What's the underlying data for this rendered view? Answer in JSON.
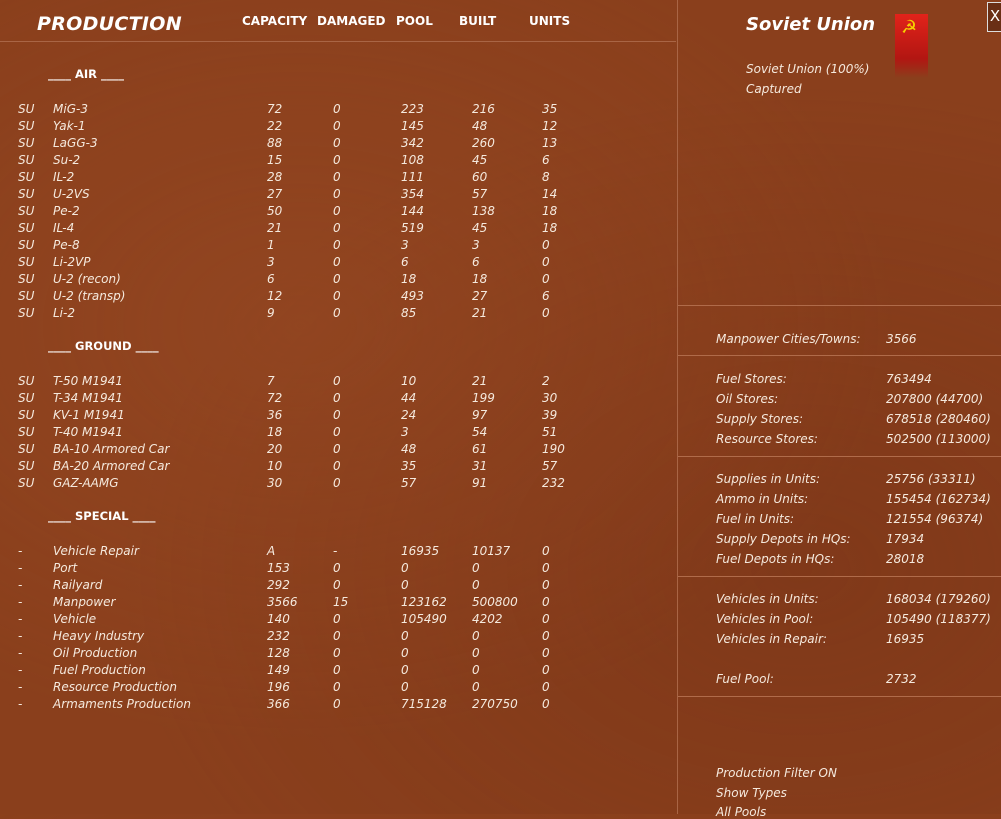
{
  "header": {
    "title": "PRODUCTION",
    "columns": {
      "capacity": "CAPACITY",
      "damaged": "DAMAGED",
      "pool": "POOL",
      "built": "BUILT",
      "units": "UNITS"
    }
  },
  "sections": [
    {
      "label": "____  AIR  ____",
      "rows": [
        [
          "SU",
          "MiG-3",
          "72",
          "0",
          "223",
          "216",
          "35"
        ],
        [
          "SU",
          "Yak-1",
          "22",
          "0",
          "145",
          "48",
          "12"
        ],
        [
          "SU",
          "LaGG-3",
          "88",
          "0",
          "342",
          "260",
          "13"
        ],
        [
          "SU",
          "Su-2",
          "15",
          "0",
          "108",
          "45",
          "6"
        ],
        [
          "SU",
          "IL-2",
          "28",
          "0",
          "111",
          "60",
          "8"
        ],
        [
          "SU",
          "U-2VS",
          "27",
          "0",
          "354",
          "57",
          "14"
        ],
        [
          "SU",
          "Pe-2",
          "50",
          "0",
          "144",
          "138",
          "18"
        ],
        [
          "SU",
          "IL-4",
          "21",
          "0",
          "519",
          "45",
          "18"
        ],
        [
          "SU",
          "Pe-8",
          "1",
          "0",
          "3",
          "3",
          "0"
        ],
        [
          "SU",
          "Li-2VP",
          "3",
          "0",
          "6",
          "6",
          "0"
        ],
        [
          "SU",
          "U-2 (recon)",
          "6",
          "0",
          "18",
          "18",
          "0"
        ],
        [
          "SU",
          "U-2 (transp)",
          "12",
          "0",
          "493",
          "27",
          "6"
        ],
        [
          "SU",
          "Li-2",
          "9",
          "0",
          "85",
          "21",
          "0"
        ]
      ]
    },
    {
      "label": "____ GROUND ____",
      "rows": [
        [
          "SU",
          "T-50 M1941",
          "7",
          "0",
          "10",
          "21",
          "2"
        ],
        [
          "SU",
          "T-34 M1941",
          "72",
          "0",
          "44",
          "199",
          "30"
        ],
        [
          "SU",
          "KV-1 M1941",
          "36",
          "0",
          "24",
          "97",
          "39"
        ],
        [
          "SU",
          "T-40 M1941",
          "18",
          "0",
          "3",
          "54",
          "51"
        ],
        [
          "SU",
          "BA-10 Armored Car",
          "20",
          "0",
          "48",
          "61",
          "190"
        ],
        [
          "SU",
          "BA-20 Armored Car",
          "10",
          "0",
          "35",
          "31",
          "57"
        ],
        [
          "SU",
          "GAZ-AAMG",
          "30",
          "0",
          "57",
          "91",
          "232"
        ]
      ]
    },
    {
      "label": "____ SPECIAL ____",
      "rows": [
        [
          "-",
          "Vehicle Repair",
          "A",
          "-",
          "16935",
          "10137",
          "0"
        ],
        [
          "-",
          "Port",
          "153",
          "0",
          "0",
          "0",
          "0"
        ],
        [
          "-",
          "Railyard",
          "292",
          "0",
          "0",
          "0",
          "0"
        ],
        [
          "-",
          "Manpower",
          "3566",
          "15",
          "123162",
          "500800",
          "0"
        ],
        [
          "-",
          "Vehicle",
          "140",
          "0",
          "105490",
          "4202",
          "0"
        ],
        [
          "-",
          "Heavy Industry",
          "232",
          "0",
          "0",
          "0",
          "0"
        ],
        [
          "-",
          "Oil Production",
          "128",
          "0",
          "0",
          "0",
          "0"
        ],
        [
          "-",
          "Fuel Production",
          "149",
          "0",
          "0",
          "0",
          "0"
        ],
        [
          "-",
          "Resource Production",
          "196",
          "0",
          "0",
          "0",
          "0"
        ],
        [
          "-",
          "Armaments Production",
          "366",
          "0",
          "715128",
          "270750",
          "0"
        ]
      ]
    }
  ],
  "nation": {
    "name": "Soviet Union",
    "control": "Soviet Union  (100%)",
    "status": "Captured",
    "flag_colors": {
      "field": "#e2231a",
      "emblem": "#f5d000"
    },
    "flag_emblem": "☭",
    "close_label": "X"
  },
  "stats": [
    {
      "label": "Manpower Cities/Towns:",
      "value": "3566"
    },
    {
      "label": "Fuel Stores:",
      "value": "763494"
    },
    {
      "label": "Oil Stores:",
      "value": "207800 (44700)"
    },
    {
      "label": "Supply Stores:",
      "value": "678518 (280460)"
    },
    {
      "label": "Resource Stores:",
      "value": "502500 (113000)"
    },
    {
      "label": "Supplies in Units:",
      "value": "25756 (33311)"
    },
    {
      "label": "Ammo in Units:",
      "value": "155454 (162734)"
    },
    {
      "label": "Fuel in Units:",
      "value": "121554 (96374)"
    },
    {
      "label": "Supply Depots in HQs:",
      "value": "17934"
    },
    {
      "label": "Fuel Depots in HQs:",
      "value": "28018"
    },
    {
      "label": "Vehicles in Units:",
      "value": "168034 (179260)"
    },
    {
      "label": "Vehicles in Pool:",
      "value": "105490 (118377)"
    },
    {
      "label": "Vehicles in Repair:",
      "value": "16935"
    },
    {
      "label": "Fuel Pool:",
      "value": "2732"
    }
  ],
  "filters": {
    "production_filter": "Production Filter ON",
    "show_types": "Show Types",
    "all_pools": "All Pools"
  }
}
